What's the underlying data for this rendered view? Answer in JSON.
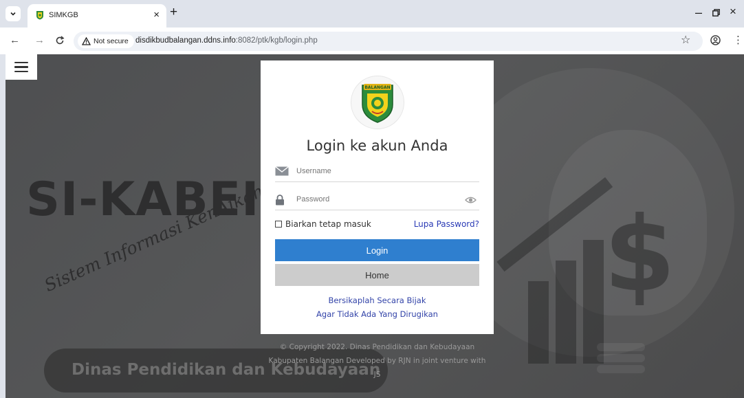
{
  "browser": {
    "tab_title": "SIMKGB",
    "new_tab_symbol": "+",
    "close_symbol": "×",
    "security_label": "Not secure",
    "url_host": "disdikbudbalangan.ddns.info",
    "url_path": ":8082/ptk/kgb/login.php",
    "icons": [
      "tab-search-icon",
      "favicon-icon",
      "close-icon",
      "back-icon",
      "forward-icon",
      "reload-icon",
      "warning-icon",
      "star-icon",
      "profile-icon",
      "menu-dots-icon",
      "minimize-icon",
      "restore-icon",
      "window-close-icon"
    ]
  },
  "hero": {
    "title": "SI-KABEI",
    "subtitle": "Sistem Informasi KenAikan G",
    "pill_text": "Dinas Pendidikan dan Kebudayaan"
  },
  "login": {
    "logo_text": "BALANGAN",
    "title": "Login ke akun Anda",
    "username_placeholder": "Username",
    "password_placeholder": "Password",
    "remember_label": "Biarkan tetap masuk",
    "forgot_label": "Lupa Password?",
    "login_button": "Login",
    "home_button": "Home",
    "motto_line1": "Bersikaplah Secara Bijak",
    "motto_line2": "Agar Tidak Ada Yang Dirugikan"
  },
  "footer": {
    "line1": "© Copyright 2022. Dinas Pendidikan dan Kebudayaan",
    "line2": "Kabupaten Balangan Developed by RJN in joint venture with",
    "line3": "JS"
  },
  "colors": {
    "login_button_bg": "#2f7fcf",
    "home_button_bg": "#cccccc",
    "link": "#2a3ab5",
    "page_bg": "#525354"
  }
}
